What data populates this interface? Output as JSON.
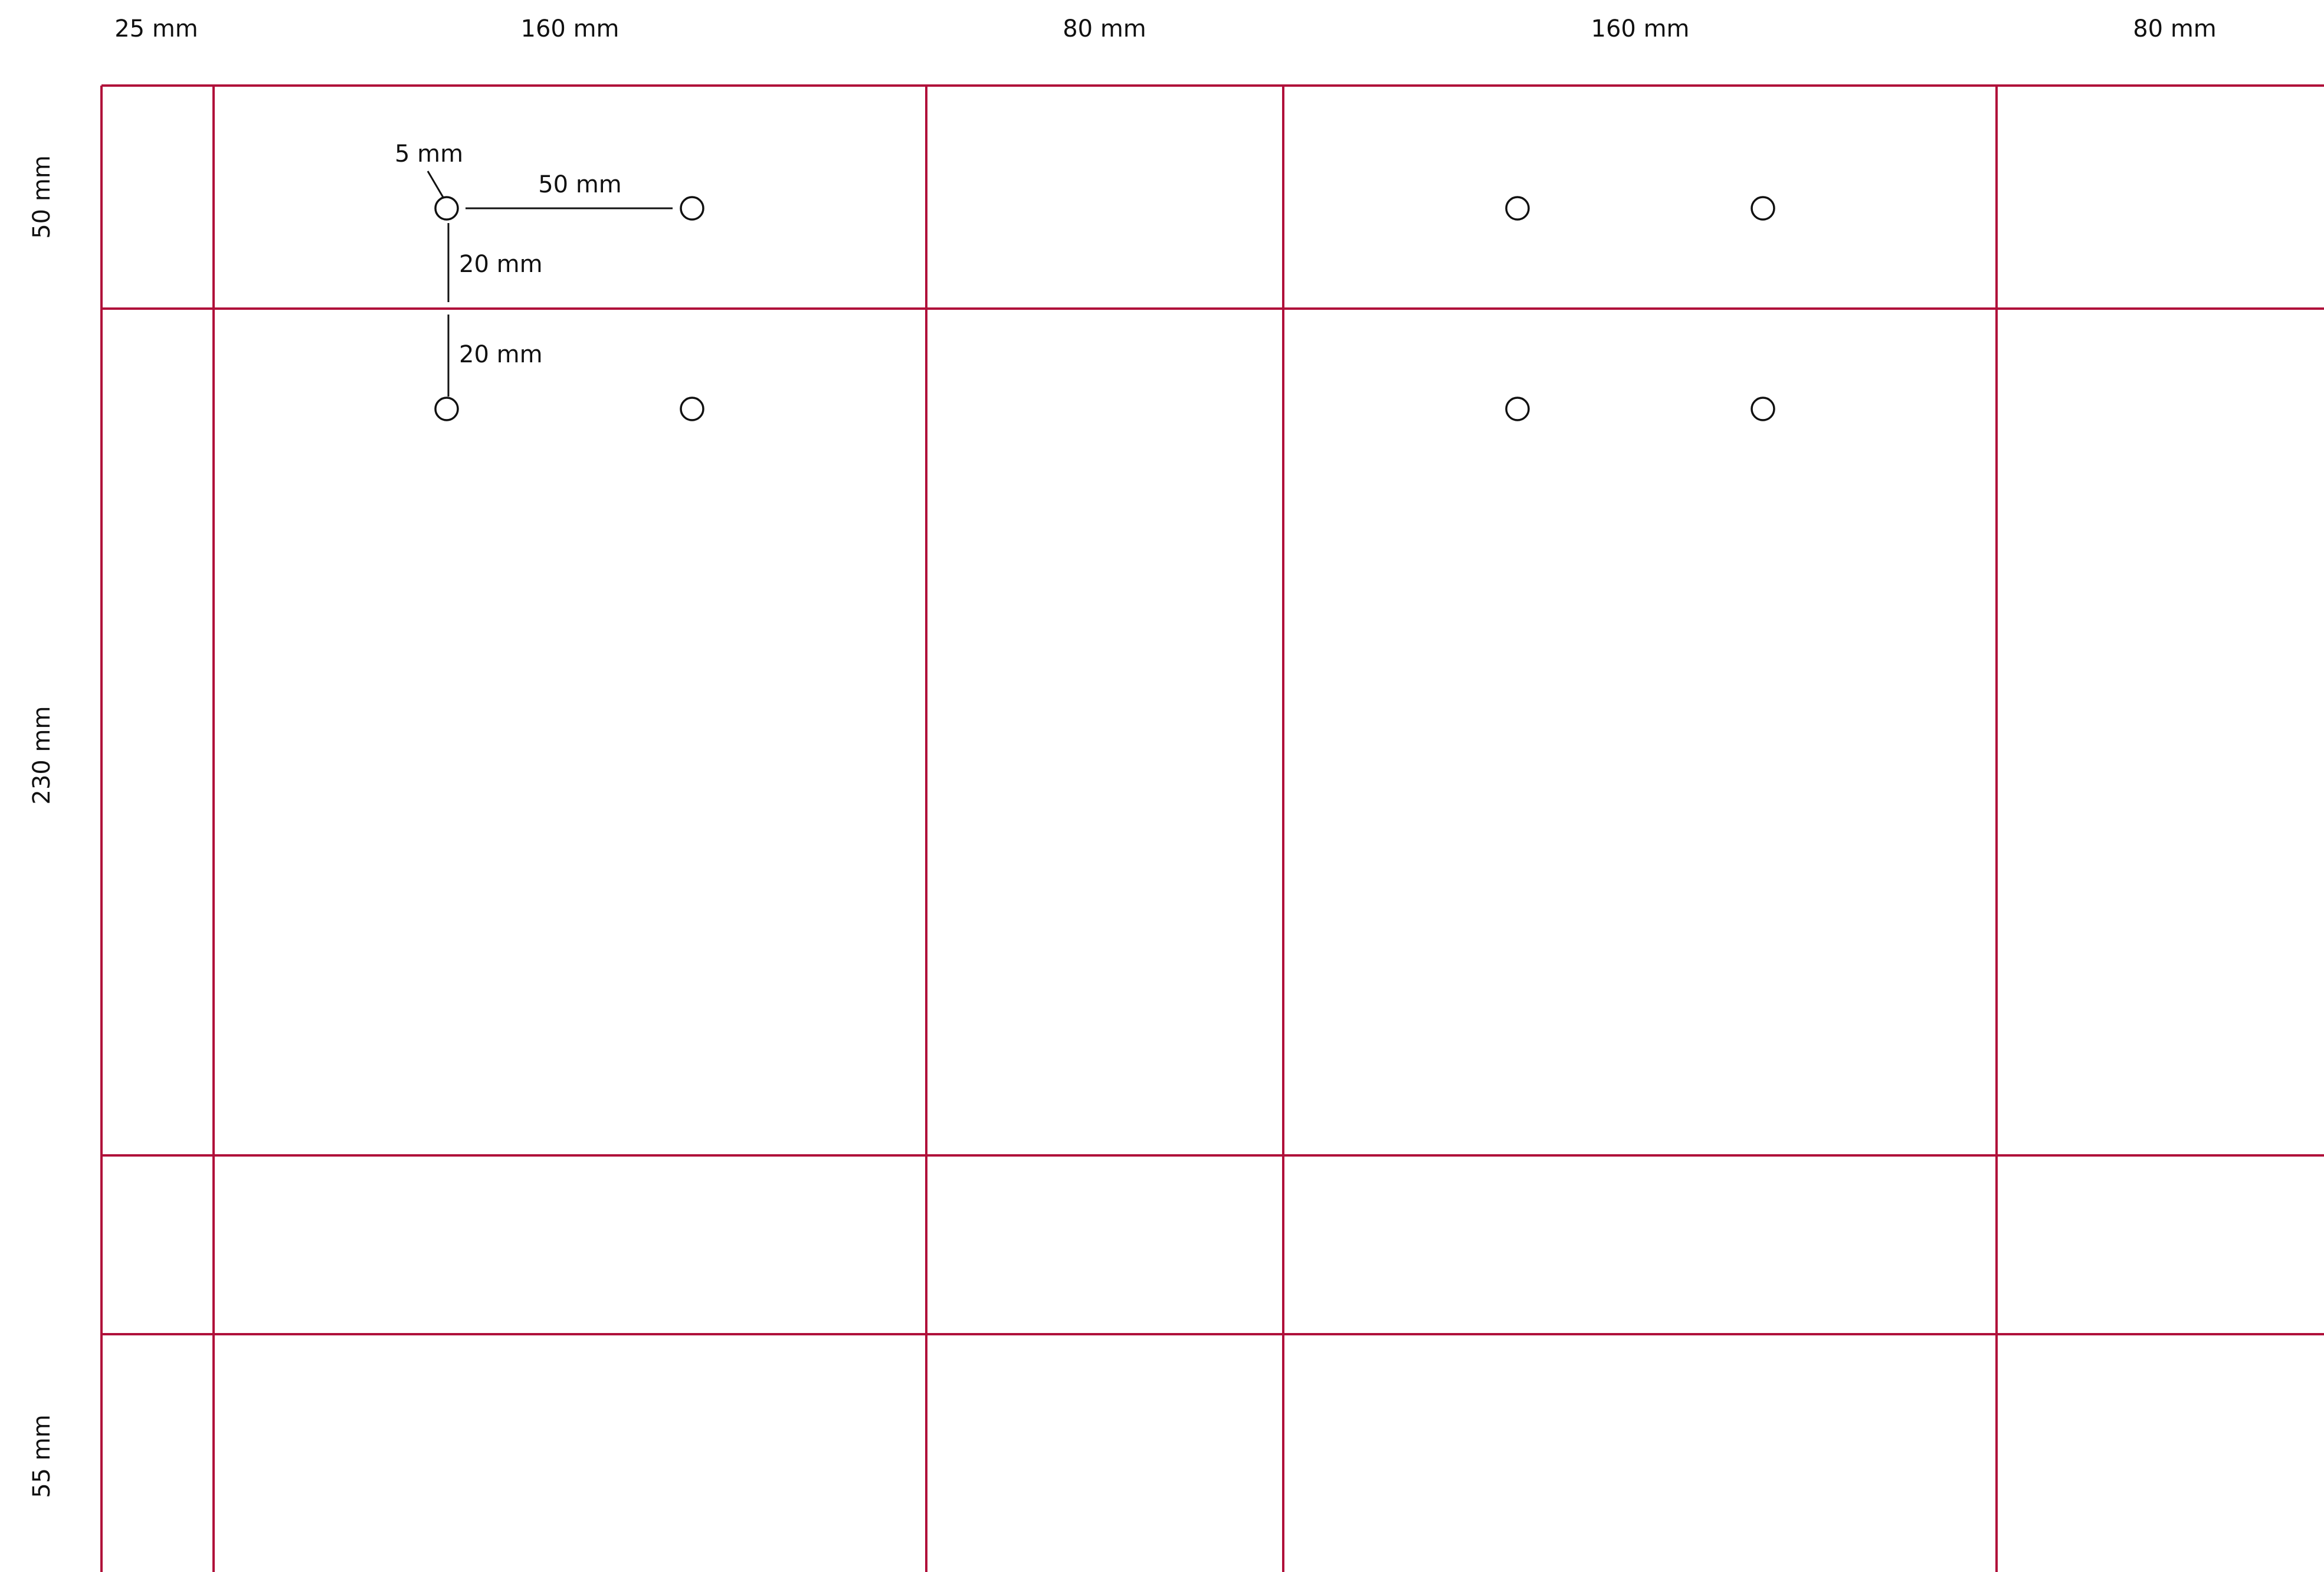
{
  "diagram": {
    "column_labels": [
      "25 mm",
      "160 mm",
      "80 mm",
      "160 mm",
      "80 mm"
    ],
    "row_labels": [
      "50 mm",
      "230 mm",
      "55 mm"
    ],
    "annotations": {
      "hole_diameter": "5 mm",
      "horizontal_spacing": "50 mm",
      "vertical_spacing_upper": "20 mm",
      "vertical_spacing_lower": "20 mm"
    },
    "colors": {
      "grid_line": "#b0103a",
      "dimension_line": "#111111"
    }
  }
}
